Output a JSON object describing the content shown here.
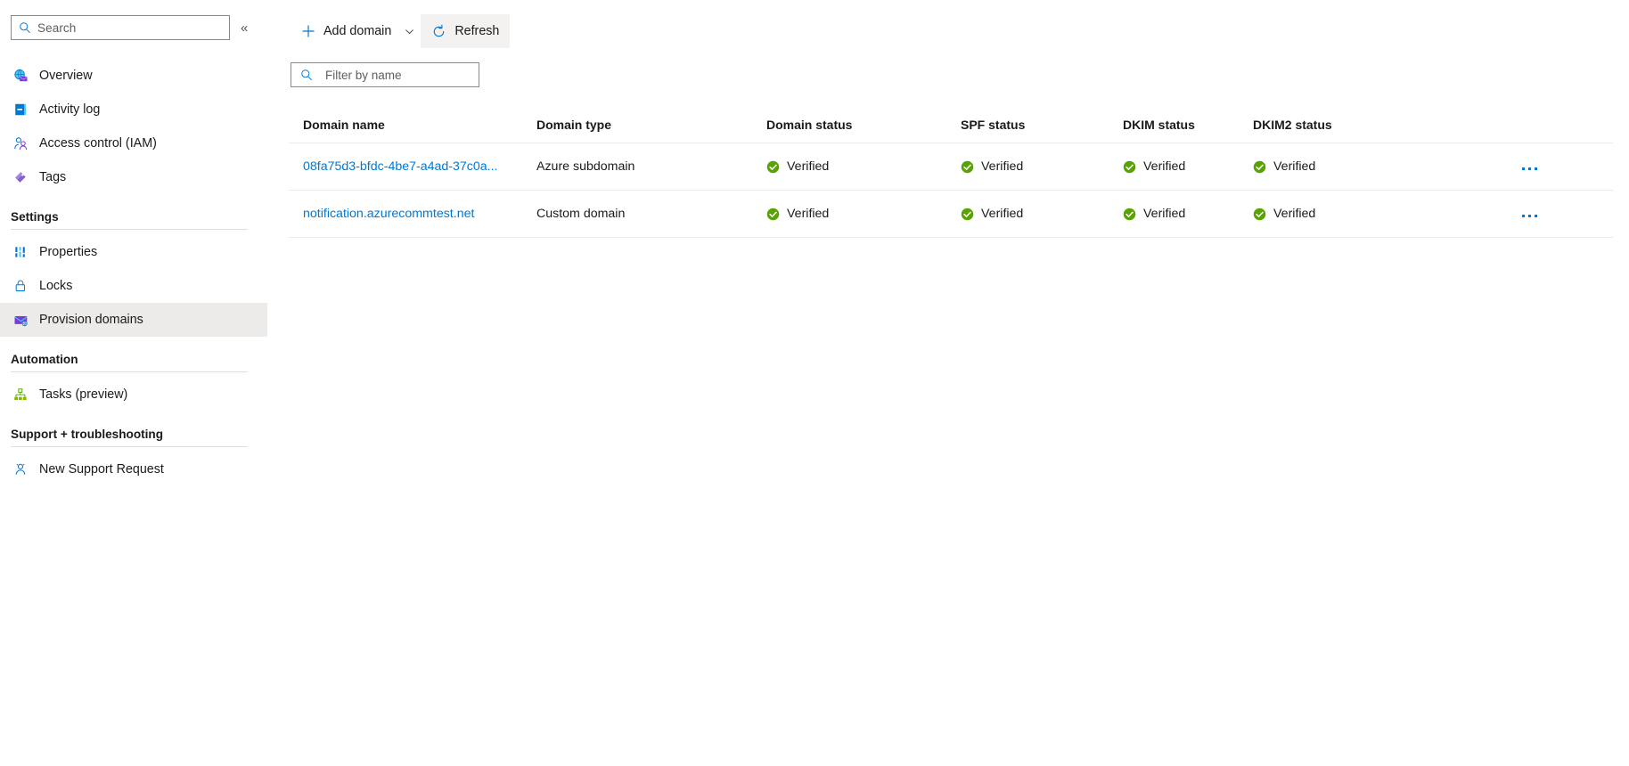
{
  "sidebar": {
    "search": {
      "placeholder": "Search",
      "value": "",
      "icon": "search-icon"
    },
    "collapse": {
      "icon": "chevron-double-left-icon",
      "glyph": "«"
    },
    "items": [
      {
        "label": "Overview",
        "icon": "overview-email-icon",
        "selected": false
      },
      {
        "label": "Activity log",
        "icon": "activity-log-icon",
        "selected": false
      },
      {
        "label": "Access control (IAM)",
        "icon": "access-control-icon",
        "selected": false
      },
      {
        "label": "Tags",
        "icon": "tags-icon",
        "selected": false
      }
    ],
    "groups": [
      {
        "title": "Settings",
        "items": [
          {
            "label": "Properties",
            "icon": "properties-icon",
            "selected": false
          },
          {
            "label": "Locks",
            "icon": "lock-icon",
            "selected": false
          },
          {
            "label": "Provision domains",
            "icon": "provision-domains-icon",
            "selected": true
          }
        ]
      },
      {
        "title": "Automation",
        "items": [
          {
            "label": "Tasks (preview)",
            "icon": "tasks-icon",
            "selected": false
          }
        ]
      },
      {
        "title": "Support + troubleshooting",
        "items": [
          {
            "label": "New Support Request",
            "icon": "support-request-icon",
            "selected": false
          }
        ]
      }
    ]
  },
  "toolbar": {
    "add_domain_label": "Add domain",
    "add_domain_icon": "plus-icon",
    "add_domain_chevron_icon": "chevron-down-icon",
    "refresh_label": "Refresh",
    "refresh_icon": "refresh-icon"
  },
  "filter": {
    "placeholder": "Filter by name",
    "value": "",
    "icon": "search-icon"
  },
  "table": {
    "columns": [
      "Domain name",
      "Domain type",
      "Domain status",
      "SPF status",
      "DKIM status",
      "DKIM2 status"
    ],
    "rows": [
      {
        "name": "08fa75d3-bfdc-4be7-a4ad-37c0a...",
        "type": "Azure subdomain",
        "domain_status": "Verified",
        "spf_status": "Verified",
        "dkim_status": "Verified",
        "dkim2_status": "Verified",
        "actions_icon": "more-options-icon"
      },
      {
        "name": "notification.azurecommtest.net",
        "type": "Custom domain",
        "domain_status": "Verified",
        "spf_status": "Verified",
        "dkim_status": "Verified",
        "dkim2_status": "Verified",
        "actions_icon": "more-options-icon"
      }
    ]
  },
  "colors": {
    "link": "#0078d4",
    "success": "#57a300",
    "selected_bg": "#edebe9",
    "hover_bg": "#f3f2f1",
    "border": "#8a8886",
    "grid_line": "#edebe9"
  }
}
